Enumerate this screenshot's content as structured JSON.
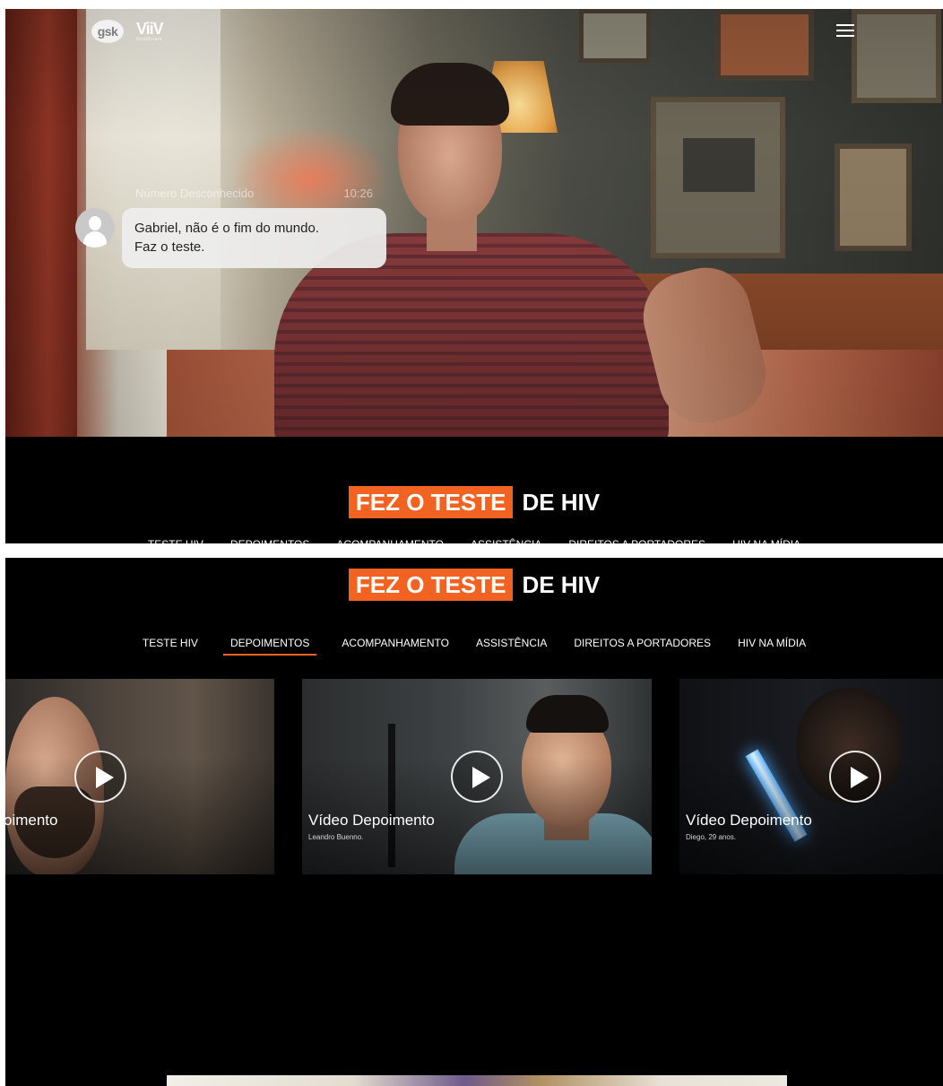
{
  "brand": {
    "gsk": "gsk",
    "viiv": "ViiV",
    "viiv_sub": "Healthcare"
  },
  "notification": {
    "sender": "Número Desconhecido",
    "time": "10:26",
    "message_line1": "Gabriel, não é o fim do mundo.",
    "message_line2": "Faz o teste."
  },
  "title": {
    "highlight": "FEZ O TESTE",
    "rest": "DE HIV"
  },
  "nav": {
    "items": [
      {
        "label": "TESTE HIV",
        "active": false
      },
      {
        "label": "DEPOIMENTOS",
        "active": true
      },
      {
        "label": "ACOMPANHAMENTO",
        "active": false
      },
      {
        "label": "ASSISTÊNCIA",
        "active": false
      },
      {
        "label": "DIREITOS A PORTADORES",
        "active": false
      },
      {
        "label": "HIV NA MÍDIA",
        "active": false
      }
    ]
  },
  "videos": [
    {
      "title": "oimento",
      "subtitle": ""
    },
    {
      "title": "Vídeo Depoimento",
      "subtitle": "Leandro Buenno."
    },
    {
      "title": "Vídeo Depoimento",
      "subtitle": "Diego, 29 anos."
    }
  ],
  "colors": {
    "accent": "#f26322",
    "background": "#000000"
  },
  "icons": {
    "menu": "hamburger-menu-icon",
    "play": "play-icon",
    "avatar": "user-avatar-icon"
  }
}
